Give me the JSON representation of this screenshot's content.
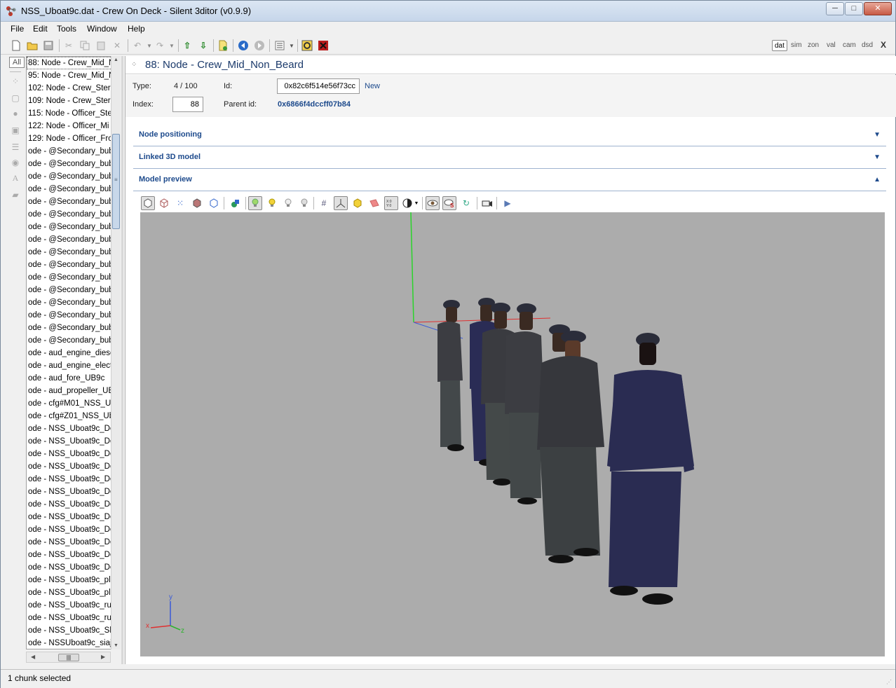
{
  "window": {
    "title": "NSS_Uboat9c.dat - Crew On Deck - Silent 3ditor (v0.9.9)",
    "controls": {
      "minimize": "─",
      "maximize": "□",
      "close": "✕"
    }
  },
  "menu": [
    "File",
    "Edit",
    "Tools",
    "Window",
    "Help"
  ],
  "toolbar": {
    "modes": [
      "dat",
      "sim",
      "zon",
      "val",
      "cam",
      "dsd"
    ],
    "active_mode": "dat",
    "close_label": "X"
  },
  "left_strip": {
    "all_label": "All"
  },
  "chunk_list": {
    "items": [
      "88: Node - Crew_Mid_N",
      "95: Node - Crew_Mid_N",
      "102: Node - Crew_Stern",
      "109: Node - Crew_Stern",
      "115: Node - Officer_Ste",
      "122: Node - Officer_Mi",
      "129: Node - Officer_Fro",
      "ode - @Secondary_bub",
      "ode - @Secondary_bub",
      "ode - @Secondary_bub",
      "ode - @Secondary_bub",
      "ode - @Secondary_bub",
      "ode - @Secondary_bub",
      "ode - @Secondary_bub",
      "ode - @Secondary_bub",
      "ode - @Secondary_bub",
      "ode - @Secondary_bub",
      "ode - @Secondary_bub",
      "ode - @Secondary_bub",
      "ode - @Secondary_bub",
      "ode - @Secondary_bub",
      "ode - @Secondary_bub",
      "ode - @Secondary_bub",
      "ode - aud_engine_diese",
      "ode - aud_engine_elect",
      "ode - aud_fore_UB9c",
      "ode - aud_propeller_UE",
      "ode - cfg#M01_NSS_Ub",
      "ode - cfg#Z01_NSS_Ubc",
      "ode - NSS_Uboat9c_Doc",
      "ode - NSS_Uboat9c_Doc",
      "ode - NSS_Uboat9c_Doc",
      "ode - NSS_Uboat9c_Doc",
      "ode - NSS_Uboat9c_Doc",
      "ode - NSS_Uboat9c_Doc",
      "ode - NSS_Uboat9c_Doc",
      "ode - NSS_Uboat9c_Doc",
      "ode - NSS_Uboat9c_Doc",
      "ode - NSS_Uboat9c_Doc",
      "ode - NSS_Uboat9c_Doc",
      "ode - NSS_Uboat9c_Doc",
      "ode - NSS_Uboat9c_pla",
      "ode - NSS_Uboat9c_pla",
      "ode - NSS_Uboat9c_rud",
      "ode - NSS_Uboat9c_rud",
      "ode - NSS_Uboat9c_Shi",
      "ode - NSSUboat9c_siajF"
    ],
    "selected_index": 0
  },
  "detail": {
    "title": "88: Node - Crew_Mid_Non_Beard",
    "type_label": "Type:",
    "type_value": "4 / 100",
    "id_label": "Id:",
    "id_value": "0x82c6f514e56f73cc",
    "new_link": "New",
    "index_label": "Index:",
    "index_value": "88",
    "parent_label": "Parent id:",
    "parent_value": "0x6866f4dccff07b84"
  },
  "sections": [
    {
      "title": "Node positioning",
      "expanded": false
    },
    {
      "title": "Linked 3D model",
      "expanded": false
    },
    {
      "title": "Model preview",
      "expanded": true
    }
  ],
  "viewport": {
    "background": "#acacac",
    "axis_labels": {
      "x": "x",
      "y": "y",
      "z": "z"
    }
  },
  "status": {
    "text": "1 chunk selected"
  }
}
